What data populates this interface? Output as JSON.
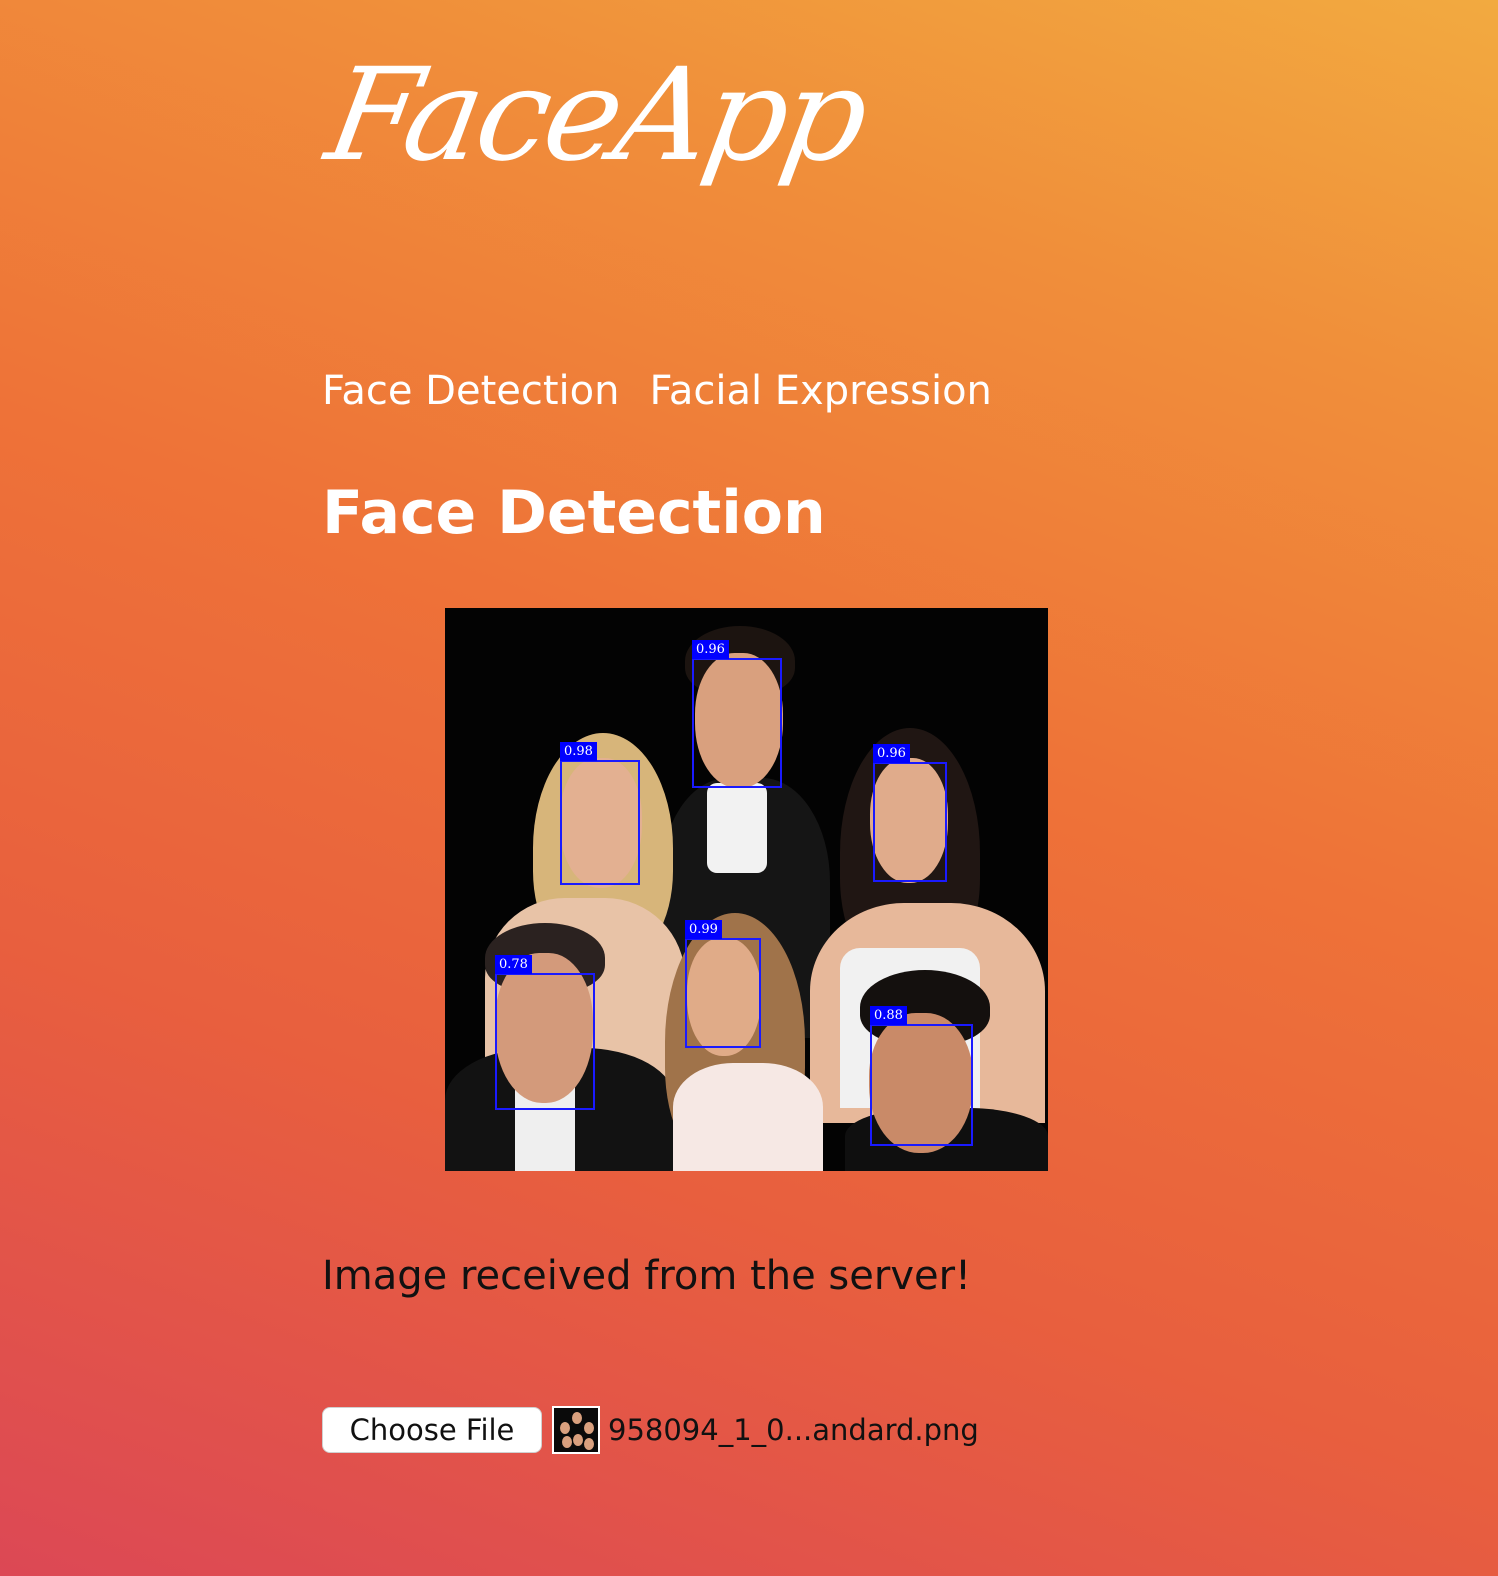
{
  "app": {
    "logo_text": "FaceApp"
  },
  "nav": {
    "items": [
      "Face Detection",
      "Facial Expression"
    ]
  },
  "page": {
    "heading": "Face Detection",
    "status_message": "Image received from the server!"
  },
  "detections": {
    "scores": [
      "0.96",
      "0.98",
      "0.96",
      "0.99",
      "0.78",
      "0.88"
    ]
  },
  "file_input": {
    "button_label": "Choose File",
    "file_name": "958094_1_0...andard.png"
  },
  "colors": {
    "background_start": "#dc4855",
    "background_end": "#f2aa40",
    "box_color": "#0000ff",
    "text_white": "#ffffff",
    "text_dark": "#111111"
  }
}
